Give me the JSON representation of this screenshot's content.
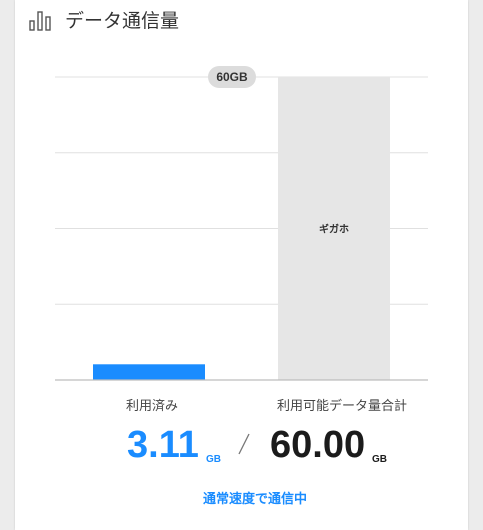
{
  "header": {
    "title": "データ通信量",
    "icon": "bar-chart-icon"
  },
  "chart_data": {
    "type": "bar",
    "categories": [
      "利用済み",
      "利用可能データ量合計"
    ],
    "values": [
      3.11,
      60.0
    ],
    "ylim": [
      0,
      60
    ],
    "grid": true,
    "top_badge": "60GB",
    "bar_inner_label": "ギガホ",
    "colors": [
      "#1a8cff",
      "#e6e6e6"
    ]
  },
  "summary": {
    "used_label": "利用済み",
    "used_value": "3.11",
    "used_unit": "GB",
    "total_label": "利用可能データ量合計",
    "total_value": "60.00",
    "total_unit": "GB"
  },
  "status": "通常速度で通信中",
  "colors": {
    "accent": "#1a8cff",
    "text_dark": "#1b1b1b"
  }
}
